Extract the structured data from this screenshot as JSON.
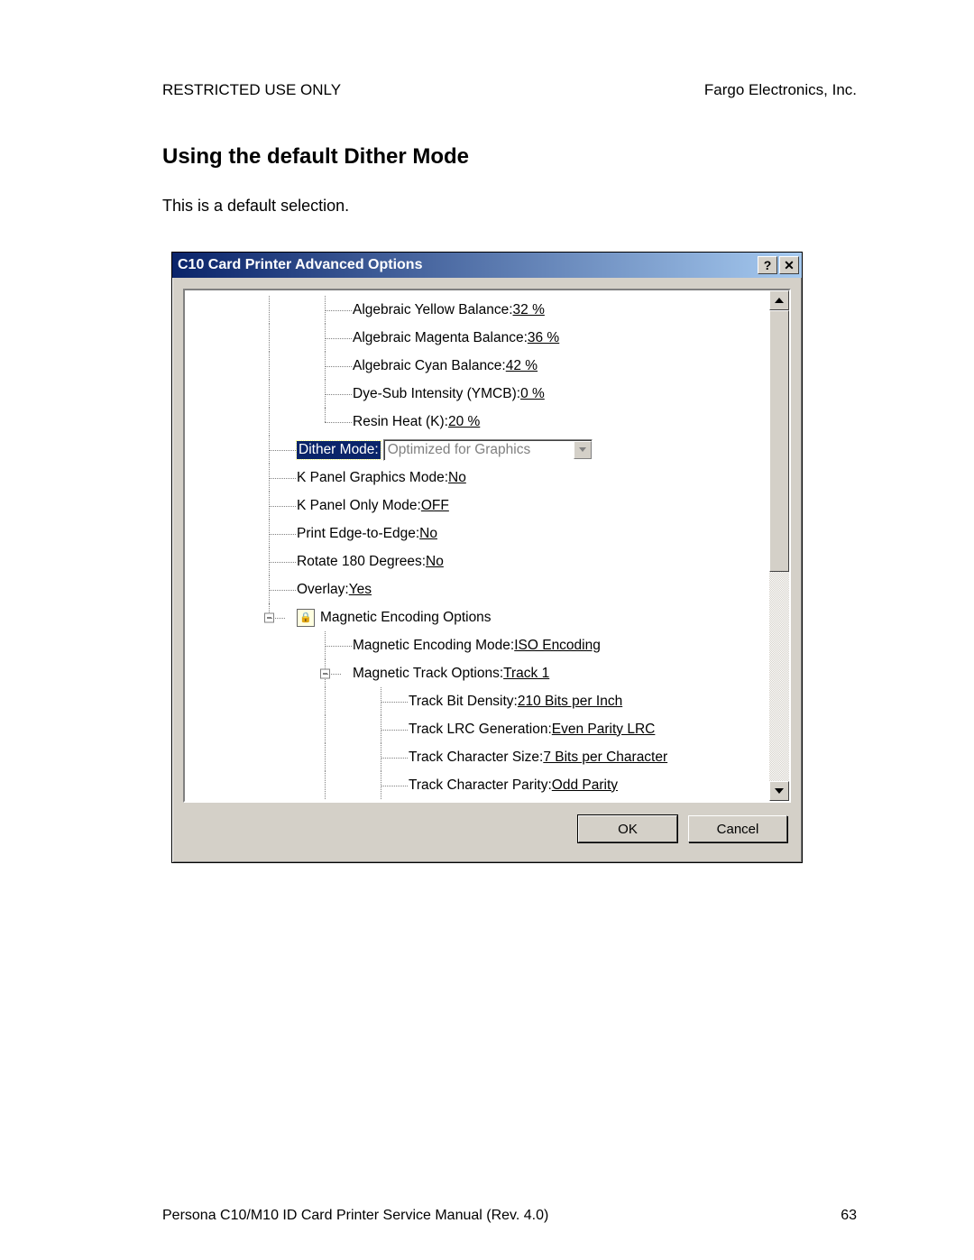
{
  "header": {
    "left": "RESTRICTED USE ONLY",
    "right": "Fargo Electronics, Inc."
  },
  "section_heading": "Using the default Dither Mode",
  "body_text": "This is a default selection.",
  "dialog": {
    "title": "C10 Card Printer Advanced Options",
    "help_glyph": "?",
    "close_glyph": "✕",
    "ok": "OK",
    "cancel": "Cancel"
  },
  "tree": {
    "lock_glyph": "🔒",
    "items": [
      {
        "label": "Algebraic Yellow Balance: ",
        "value": "32 %"
      },
      {
        "label": "Algebraic Magenta Balance: ",
        "value": "36 %"
      },
      {
        "label": "Algebraic Cyan Balance: ",
        "value": "42 %"
      },
      {
        "label": "Dye-Sub Intensity (YMCB): ",
        "value": "0 %"
      },
      {
        "label": "Resin Heat (K): ",
        "value": "20 %"
      }
    ],
    "dither": {
      "label": "Dither Mode:",
      "value": "Optimized for Graphics"
    },
    "after": [
      {
        "label": "K Panel Graphics Mode: ",
        "value": "No"
      },
      {
        "label": "K Panel Only Mode: ",
        "value": "OFF"
      },
      {
        "label": "Print Edge-to-Edge: ",
        "value": "No"
      },
      {
        "label": "Rotate 180 Degrees: ",
        "value": "No"
      },
      {
        "label": "Overlay: ",
        "value": "Yes"
      }
    ],
    "mag_header": "Magnetic Encoding Options",
    "mag1": {
      "label": "Magnetic Encoding Mode: ",
      "value": "ISO Encoding"
    },
    "mag2": {
      "label": "Magnetic Track Options: ",
      "value": "Track 1"
    },
    "tracks": [
      {
        "label": "Track Bit Density: ",
        "value": "210 Bits per Inch"
      },
      {
        "label": "Track LRC Generation: ",
        "value": "Even Parity LRC"
      },
      {
        "label": "Track Character Size: ",
        "value": "7 Bits per Character"
      },
      {
        "label": "Track Character Parity: ",
        "value": "Odd Parity"
      }
    ]
  },
  "footer": {
    "left": "Persona C10/M10 ID Card Printer Service Manual (Rev. 4.0)",
    "right": "63"
  }
}
